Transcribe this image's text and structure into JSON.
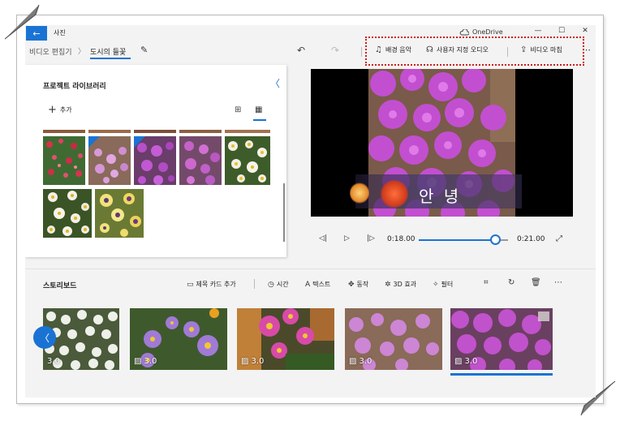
{
  "window": {
    "app_title": "사진",
    "onedrive_label": "OneDrive",
    "controls": {
      "minimize": "—",
      "maximize": "☐",
      "close": "✕"
    }
  },
  "toolbar": {
    "breadcrumb_parent": "비디오 편집기",
    "breadcrumb_sep": "〉",
    "breadcrumb_current": "도시의 들꽃",
    "rename_icon": "✎",
    "undo_icon": "↶",
    "redo_icon": "↷",
    "background_music_label": "배경 음악",
    "custom_audio_label": "사용자 지정 오디오",
    "finish_video_label": "비디오 마침",
    "more_icon": "⋯",
    "highlight_color": "#cc1f1f"
  },
  "library": {
    "title": "프로젝트 라이브러리",
    "add_label": "추가",
    "collapse_icon": "〈",
    "view_large_icon": "⊞",
    "view_small_icon": "▦"
  },
  "preview": {
    "caption_text": "안 녕"
  },
  "playback": {
    "prev_icon": "◁|",
    "play_icon": "▷",
    "next_icon": "|▷",
    "current_time": "0:18.00",
    "total_time": "0:21.00",
    "fullscreen_icon": "⤢",
    "progress_fraction": 0.857
  },
  "storyboard": {
    "title": "스토리보드",
    "tools": {
      "title_card": "제목 카드 추가",
      "duration": "시간",
      "text": "텍스트",
      "motion": "동작",
      "effects_3d": "3D 효과",
      "filters": "필터"
    },
    "clips": [
      {
        "duration": "3.0"
      },
      {
        "duration": "3.0"
      },
      {
        "duration": "3.0"
      },
      {
        "duration": "3.0"
      },
      {
        "duration": "3.0"
      }
    ],
    "accent_color": "#1a73d4"
  }
}
